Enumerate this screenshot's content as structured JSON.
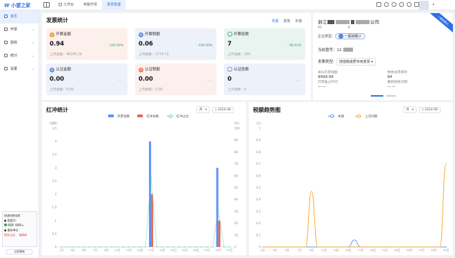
{
  "app": {
    "logo_text": "小望之家"
  },
  "topbar": {
    "tabs": [
      {
        "label": "工作台"
      },
      {
        "label": "电税开票"
      },
      {
        "label": "发票管理"
      }
    ]
  },
  "sidebar": {
    "items": [
      {
        "label": "首页"
      },
      {
        "label": "开票"
      },
      {
        "label": "验收"
      },
      {
        "label": "统计"
      },
      {
        "label": "设置"
      }
    ],
    "customer": {
      "title": "快递&数电税",
      "code_label": "报盘号:",
      "status_label": "服务单位",
      "warning": "税务认证、 请刷新"
    },
    "fold_button": "立即更新"
  },
  "invoice_stats": {
    "title": "发票统计",
    "periods": [
      "月报",
      "季度",
      "年度"
    ],
    "active_period": "月报",
    "cards": [
      {
        "title": "开票金额",
        "icon": "yen",
        "value": "0.94",
        "change": "- 100.00%",
        "last_label": "上月金额：",
        "last_value": "46245.29"
      },
      {
        "title": "开票税额",
        "icon": "yen",
        "value": "0.06",
        "change": "- 100.00%",
        "last_label": "上月税额：",
        "last_value": "2774.72"
      },
      {
        "title": "开票张数",
        "icon": "count",
        "value": "7",
        "change": "- 96.41%",
        "last_label": "上月张数：",
        "last_value": "195"
      },
      {
        "title": "认证金额",
        "icon": "yen",
        "value": "0.00",
        "change": "- -",
        "last_label": "上月金额：",
        "last_value": "0.00"
      },
      {
        "title": "认证税额",
        "icon": "yen",
        "value": "0.00",
        "change": "- -",
        "last_label": "上月税额：",
        "last_value": "0.00"
      },
      {
        "title": "认证张数",
        "icon": "count",
        "value": "0",
        "change": "- -",
        "last_label": "上月张数：",
        "last_value": "0"
      }
    ]
  },
  "company_info": {
    "ribbon": "一般纳税人",
    "name_prefix": "浙江",
    "name_suffix": "公司",
    "taxid_prefix": "91",
    "taxid_suffix": "6",
    "enterprise_type_label": "企业类型:",
    "enterprise_badge_icon": "一",
    "enterprise_type": "一般纳税人",
    "tax_period_label": "当前盘号：",
    "tax_period_value": "12",
    "invoice_type_label": "发票类型:",
    "invoice_type": "增值税纸质专用发票",
    "stats": {
      "left_a_label": "单份开票限额",
      "left_a_value": "9999.99",
      "left_b_label": "开票截止时间",
      "left_b_value": "— —",
      "right_a_label": "剩余发票库存",
      "right_a_value": "84",
      "right_b_label": "最新报税日期",
      "right_b_value": "— —"
    }
  },
  "red_chart": {
    "title": "红冲统计",
    "period_select": "月",
    "date_select": "2024-08",
    "legend": [
      {
        "name": "开票张数",
        "color": "#5b8ff9"
      },
      {
        "name": "红冲张数",
        "color": "#e8684a"
      },
      {
        "name": "红冲占比",
        "color": "#5ad8a6"
      }
    ],
    "left_unit": "(张数)",
    "right_unit": "(%)"
  },
  "tax_chart": {
    "title": "税额趋势图",
    "period_select": "月",
    "date_select": "2024-08",
    "legend": [
      {
        "name": "本期",
        "color": "#5b8ff9"
      },
      {
        "name": "上次同期",
        "color": "#f6a623"
      }
    ],
    "left_unit": "(元)"
  },
  "chart_data": [
    {
      "type": "bar",
      "title": "红冲统计",
      "categories": [
        "1日",
        "2日",
        "3日",
        "4日",
        "5日",
        "6日",
        "7日",
        "8日",
        "9日",
        "10日",
        "11日",
        "12日",
        "13日",
        "14日",
        "15日",
        "16日",
        "17日",
        "18日",
        "19日",
        "20日",
        "21日",
        "22日",
        "23日",
        "24日",
        "25日",
        "26日",
        "27日",
        "28日",
        "29日",
        "30日",
        "31日"
      ],
      "ylim": [
        0,
        4.5
      ],
      "ylim_right": [
        0,
        100
      ],
      "y_ticks": [
        0,
        0.5,
        1,
        1.5,
        2,
        2.5,
        3,
        3.5,
        4,
        4.5
      ],
      "y_right_ticks": [
        0,
        10,
        20,
        30,
        40,
        50,
        60,
        70,
        80,
        90,
        100
      ],
      "series": [
        {
          "name": "开票张数",
          "type": "bar",
          "values": [
            0,
            0,
            0,
            0,
            0,
            0,
            0,
            0,
            0,
            0,
            0,
            0,
            0,
            0,
            0,
            0,
            4,
            0,
            0,
            0,
            0,
            0,
            0,
            0,
            0,
            0,
            0,
            0,
            3,
            0,
            0,
            0
          ]
        },
        {
          "name": "红冲张数",
          "type": "bar",
          "values": [
            0,
            0,
            0,
            0,
            0,
            0,
            0,
            0,
            0,
            0,
            0,
            0,
            0,
            0,
            0,
            0,
            2,
            0,
            0,
            0,
            0,
            0,
            0,
            0,
            0,
            0,
            0,
            0,
            1,
            0,
            0,
            0
          ]
        },
        {
          "name": "红冲占比",
          "type": "line",
          "axis": "right",
          "values": [
            0,
            0,
            0,
            0,
            0,
            0,
            0,
            0,
            0,
            0,
            0,
            0,
            0,
            0,
            0,
            0,
            60,
            0,
            0,
            0,
            0,
            0,
            0,
            0,
            0,
            0,
            0,
            0,
            33,
            0,
            0,
            0
          ]
        }
      ]
    },
    {
      "type": "line",
      "title": "税额趋势图",
      "categories": [
        "1日",
        "2日",
        "3日",
        "4日",
        "5日",
        "6日",
        "7日",
        "8日",
        "9日",
        "10日",
        "11日",
        "12日",
        "13日",
        "14日",
        "15日",
        "16日",
        "17日",
        "18日",
        "19日",
        "20日",
        "21日",
        "22日",
        "23日",
        "24日",
        "25日",
        "26日",
        "27日",
        "28日",
        "29日",
        "30日",
        "31日"
      ],
      "ylim": [
        0,
        1
      ],
      "y_ticks": [
        0,
        0.1,
        0.2,
        0.3,
        0.4,
        0.5,
        0.6,
        0.7,
        0.8,
        0.9,
        1
      ],
      "series": [
        {
          "name": "本期",
          "values": [
            0,
            0,
            0,
            0,
            0,
            0,
            0,
            0,
            0,
            0,
            0,
            0,
            0,
            0,
            0,
            0.06,
            0,
            0,
            0,
            0,
            0,
            0,
            0,
            0,
            0,
            0,
            0,
            0,
            0,
            0,
            0
          ]
        },
        {
          "name": "上次同期",
          "values": [
            0,
            0,
            0,
            0,
            0,
            0,
            0,
            0,
            0.47,
            0,
            0,
            0,
            0,
            0,
            0,
            0,
            0,
            0,
            0,
            0,
            0,
            0,
            0,
            0,
            0,
            0,
            0,
            0,
            0,
            0,
            0.7
          ]
        }
      ]
    }
  ]
}
